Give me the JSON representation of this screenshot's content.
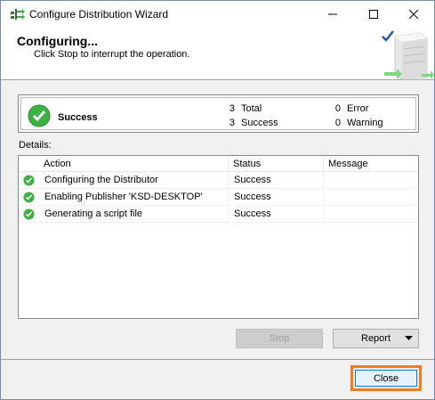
{
  "window": {
    "title": "Configure Distribution Wizard"
  },
  "header": {
    "title": "Configuring...",
    "subtitle": "Click Stop to interrupt the operation."
  },
  "summary": {
    "status": "Success",
    "total_count": "3",
    "total_label": "Total",
    "success_count": "3",
    "success_label": "Success",
    "error_count": "0",
    "error_label": "Error",
    "warning_count": "0",
    "warning_label": "Warning"
  },
  "details": {
    "label": "Details:",
    "columns": [
      "Action",
      "Status",
      "Message"
    ],
    "rows": [
      {
        "action": "Configuring the Distributor",
        "status": "Success",
        "message": ""
      },
      {
        "action": "Enabling Publisher 'KSD-DESKTOP'",
        "status": "Success",
        "message": ""
      },
      {
        "action": "Generating a script file",
        "status": "Success",
        "message": ""
      }
    ]
  },
  "buttons": {
    "stop": "Stop",
    "report": "Report",
    "close": "Close"
  },
  "colors": {
    "success_green": "#3cb043",
    "highlight_orange": "#f07c1a",
    "accent_blue": "#0078d7"
  }
}
